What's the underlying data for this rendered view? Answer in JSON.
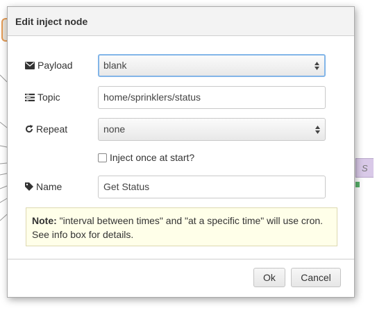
{
  "dialog": {
    "title": "Edit inject node"
  },
  "form": {
    "payload": {
      "label": "Payload",
      "value": "blank",
      "icon": "envelope-icon"
    },
    "topic": {
      "label": "Topic",
      "value": "home/sprinklers/status",
      "icon": "tasks-icon"
    },
    "repeat": {
      "label": "Repeat",
      "value": "none",
      "icon": "repeat-icon"
    },
    "inject_once": {
      "label": "Inject once at start?",
      "checked": false
    },
    "name": {
      "label": "Name",
      "value": "Get Status",
      "icon": "tag-icon"
    }
  },
  "note": {
    "bold": "Note:",
    "text": " \"interval between times\" and \"at a specific time\" will use cron. See info box for details."
  },
  "buttons": {
    "ok": "Ok",
    "cancel": "Cancel"
  },
  "colors": {
    "focus_border": "#82b5e8",
    "note_background": "#ffffe9",
    "node_orange": "#e39a54",
    "node_purple": "#d9c9e8",
    "port_green": "#58b26b"
  },
  "background_node_label": "S"
}
